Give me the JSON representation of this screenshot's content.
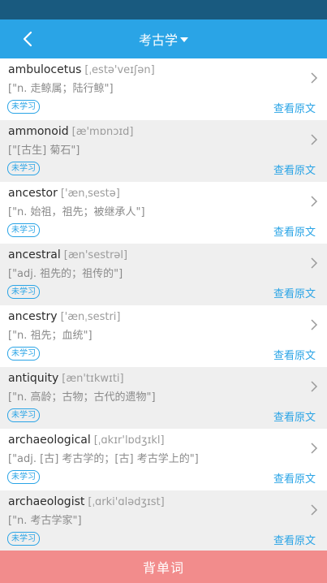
{
  "header": {
    "title": "考古学"
  },
  "rows": [
    {
      "word": "ambulocetus",
      "phonetic": "[ˌestə'veɪʃən]",
      "definition": "[\"n. 走鲸属；陆行鲸\"]",
      "status": "未学习",
      "link": "查看原文"
    },
    {
      "word": "ammonoid",
      "phonetic": "[æ'mɒnɔɪd]",
      "definition": "[\"[古生] 菊石\"]",
      "status": "未学习",
      "link": "查看原文"
    },
    {
      "word": "ancestor",
      "phonetic": "['ænˌsestə]",
      "definition": "[\"n. 始祖，祖先；被继承人\"]",
      "status": "未学习",
      "link": "查看原文"
    },
    {
      "word": "ancestral",
      "phonetic": "[æn'sestrəl]",
      "definition": "[\"adj. 祖先的；祖传的\"]",
      "status": "未学习",
      "link": "查看原文"
    },
    {
      "word": "ancestry",
      "phonetic": "['ænˌsestri]",
      "definition": "[\"n. 祖先；血统\"]",
      "status": "未学习",
      "link": "查看原文"
    },
    {
      "word": "antiquity",
      "phonetic": "[æn'tɪkwɪti]",
      "definition": "[\"n. 高龄；古物；古代的遗物\"]",
      "status": "未学习",
      "link": "查看原文"
    },
    {
      "word": "archaeological",
      "phonetic": "[ˌɑkɪr'lɒdʒɪkl]",
      "definition": "[\"adj. [古] 考古学的；[古] 考古学上的\"]",
      "status": "未学习",
      "link": "查看原文"
    },
    {
      "word": "archaeologist",
      "phonetic": "[ˌɑrki'ɑlədʒɪst]",
      "definition": "[\"n. 考古学家\"]",
      "status": "未学习",
      "link": "查看原文"
    }
  ],
  "footer": {
    "button_label": "背单词"
  }
}
